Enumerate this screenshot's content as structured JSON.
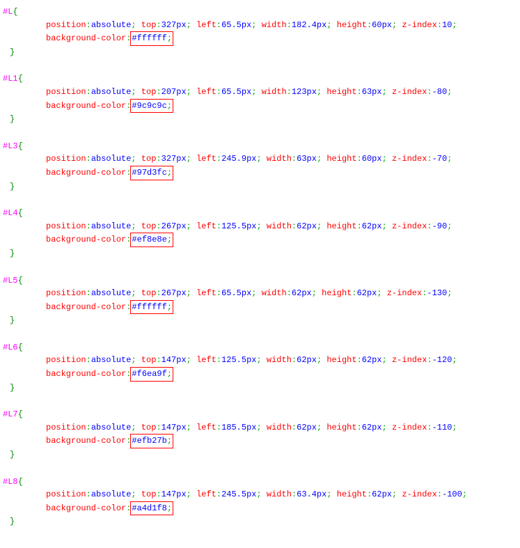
{
  "rules": [
    {
      "selector": "#L",
      "declarations": [
        [
          {
            "prop": "position",
            "val": "absolute"
          },
          {
            "prop": "top",
            "val": "327px"
          },
          {
            "prop": "left",
            "val": "65.5px"
          },
          {
            "prop": "width",
            "val": "182.4px"
          },
          {
            "prop": "height",
            "val": "60px"
          },
          {
            "prop": "z-index",
            "val": "10"
          }
        ],
        [
          {
            "prop": "background-color",
            "val": "#ffffff",
            "highlight": true
          }
        ]
      ]
    },
    {
      "selector": "#L1",
      "declarations": [
        [
          {
            "prop": "position",
            "val": "absolute"
          },
          {
            "prop": "top",
            "val": "207px"
          },
          {
            "prop": "left",
            "val": "65.5px"
          },
          {
            "prop": "width",
            "val": "123px"
          },
          {
            "prop": "height",
            "val": "63px"
          },
          {
            "prop": "z-index",
            "val": "-80"
          }
        ],
        [
          {
            "prop": "background-color",
            "val": "#9c9c9c",
            "highlight": true
          }
        ]
      ]
    },
    {
      "selector": "#L3",
      "declarations": [
        [
          {
            "prop": "position",
            "val": "absolute"
          },
          {
            "prop": "top",
            "val": "327px"
          },
          {
            "prop": "left",
            "val": "245.9px"
          },
          {
            "prop": "width",
            "val": "63px"
          },
          {
            "prop": "height",
            "val": "60px"
          },
          {
            "prop": "z-index",
            "val": "-70"
          }
        ],
        [
          {
            "prop": "background-color",
            "val": "#97d3fc",
            "highlight": true
          }
        ]
      ]
    },
    {
      "selector": "#L4",
      "declarations": [
        [
          {
            "prop": "position",
            "val": "absolute"
          },
          {
            "prop": "top",
            "val": "267px"
          },
          {
            "prop": "left",
            "val": "125.5px"
          },
          {
            "prop": "width",
            "val": "62px"
          },
          {
            "prop": "height",
            "val": "62px"
          },
          {
            "prop": "z-index",
            "val": "-90"
          }
        ],
        [
          {
            "prop": "background-color",
            "val": "#ef8e8e",
            "highlight": true
          }
        ]
      ]
    },
    {
      "selector": "#L5",
      "declarations": [
        [
          {
            "prop": "position",
            "val": "absolute"
          },
          {
            "prop": "top",
            "val": "267px"
          },
          {
            "prop": "left",
            "val": "65.5px"
          },
          {
            "prop": "width",
            "val": "62px"
          },
          {
            "prop": "height",
            "val": "62px"
          },
          {
            "prop": "z-index",
            "val": "-130"
          }
        ],
        [
          {
            "prop": "background-color",
            "val": "#ffffff",
            "highlight": true
          }
        ]
      ]
    },
    {
      "selector": "#L6",
      "declarations": [
        [
          {
            "prop": "position",
            "val": "absolute"
          },
          {
            "prop": "top",
            "val": "147px"
          },
          {
            "prop": "left",
            "val": "125.5px"
          },
          {
            "prop": "width",
            "val": "62px"
          },
          {
            "prop": "height",
            "val": "62px"
          },
          {
            "prop": "z-index",
            "val": "-120"
          }
        ],
        [
          {
            "prop": "background-color",
            "val": "#f6ea9f",
            "highlight": true
          }
        ]
      ]
    },
    {
      "selector": "#L7",
      "declarations": [
        [
          {
            "prop": "position",
            "val": "absolute"
          },
          {
            "prop": "top",
            "val": "147px"
          },
          {
            "prop": "left",
            "val": "185.5px"
          },
          {
            "prop": "width",
            "val": "62px"
          },
          {
            "prop": "height",
            "val": "62px"
          },
          {
            "prop": "z-index",
            "val": "-110"
          }
        ],
        [
          {
            "prop": "background-color",
            "val": "#efb27b",
            "highlight": true
          }
        ]
      ]
    },
    {
      "selector": "#L8",
      "declarations": [
        [
          {
            "prop": "position",
            "val": "absolute"
          },
          {
            "prop": "top",
            "val": "147px"
          },
          {
            "prop": "left",
            "val": "245.5px"
          },
          {
            "prop": "width",
            "val": "63.4px"
          },
          {
            "prop": "height",
            "val": "62px"
          },
          {
            "prop": "z-index",
            "val": "-100"
          }
        ],
        [
          {
            "prop": "background-color",
            "val": "#a4d1f8",
            "highlight": true
          }
        ]
      ]
    }
  ]
}
